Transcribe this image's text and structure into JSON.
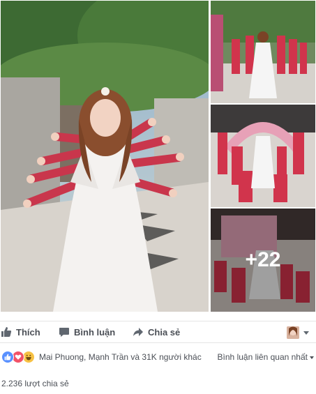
{
  "photos": {
    "more_count": "+22",
    "tiles": [
      {
        "subject": "bride-multi-arms"
      },
      {
        "subject": "bride-with-bridesmaids-outdoor"
      },
      {
        "subject": "bride-bridesmaids-under-floral-arch"
      },
      {
        "subject": "group-sitting-floral-arch"
      }
    ]
  },
  "actions": {
    "like_label": "Thích",
    "comment_label": "Bình luận",
    "share_label": "Chia sẻ"
  },
  "reactions": {
    "names": "Mai Phuong, Mạnh Trần và 31K người khác",
    "sort_label": "Bình luận liên quan nhất",
    "icons": [
      "like-icon",
      "love-icon",
      "haha-icon"
    ]
  },
  "shares": {
    "text": "2.236 lượt chia sẻ"
  },
  "colors": {
    "like_blue": "#5890ff",
    "love_red": "#f25268",
    "haha_yellow": "#f7c143",
    "text": "#4b4f56"
  }
}
